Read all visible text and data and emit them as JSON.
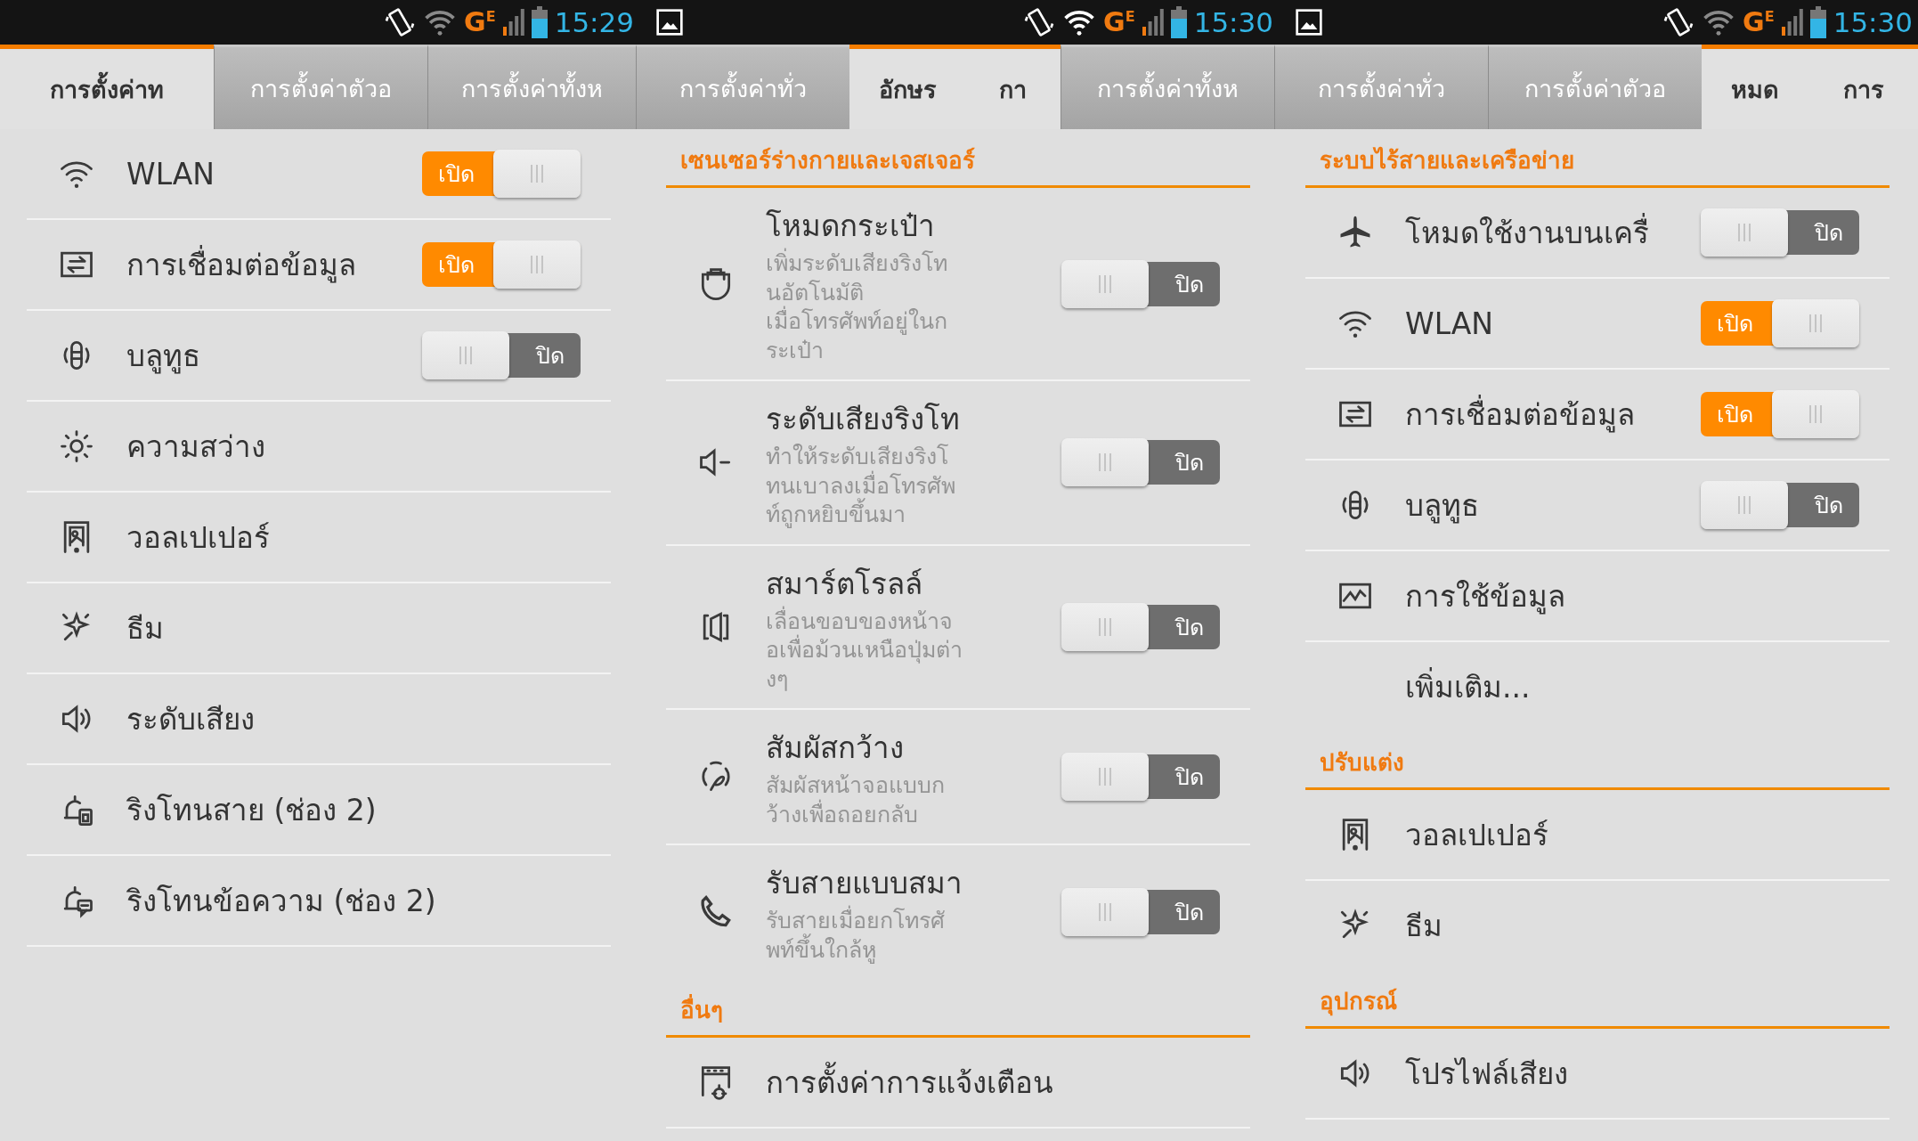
{
  "status_bar": [
    {
      "picture_notification": false,
      "network": "G",
      "network_sub": "E",
      "wifi_connected": false,
      "time": "15:29"
    },
    {
      "picture_notification": true,
      "network": "G",
      "network_sub": "E",
      "wifi_connected": true,
      "time": "15:30"
    },
    {
      "picture_notification": true,
      "network": "G",
      "network_sub": "E",
      "wifi_connected": false,
      "time": "15:30"
    }
  ],
  "tabs": [
    {
      "label": "การตั้งค่าท",
      "selected": true
    },
    {
      "label": "การตั้งค่าตัวอ",
      "selected": false
    },
    {
      "label": "การตั้งค่าทั้งห",
      "selected": false
    },
    {
      "label": "การตั้งค่าทั่ว",
      "selected": false
    },
    {
      "label": "อักษร",
      "selected": true
    },
    {
      "label": "กา",
      "selected": true
    },
    {
      "label": "การตั้งค่าทั้งห",
      "selected": false
    },
    {
      "label": "การตั้งค่าทั่ว",
      "selected": false
    },
    {
      "label": "การตั้งค่าตัวอ",
      "selected": false
    },
    {
      "label": "หมด",
      "selected": true
    },
    {
      "label": "การ",
      "selected": true
    }
  ],
  "panels": [
    {
      "items": [
        {
          "kind": "wifi",
          "title": "WLAN",
          "switch": {
            "on": true,
            "label": "เปิด"
          }
        },
        {
          "kind": "data",
          "title": "การเชื่อมต่อข้อมูล",
          "switch": {
            "on": true,
            "label": "เปิด"
          }
        },
        {
          "kind": "bluetooth",
          "title": "บลูทูธ",
          "switch": {
            "on": false,
            "label": "ปิด"
          }
        },
        {
          "kind": "brightness",
          "title": "ความสว่าง"
        },
        {
          "kind": "wallpaper",
          "title": "วอลเปเปอร์"
        },
        {
          "kind": "theme",
          "title": "ธีม"
        },
        {
          "kind": "volume",
          "title": "ระดับเสียง"
        },
        {
          "kind": "ringtone",
          "title": "ริงโทนสาย (ช่อง 2)"
        },
        {
          "kind": "message",
          "title": "ริงโทนข้อความ (ช่อง 2)"
        }
      ]
    },
    {
      "items": [
        {
          "kind": "header",
          "title": "เซนเซอร์ร่างกายและเจสเจอร์"
        },
        {
          "kind": "pocket",
          "title": "โหมดกระเป๋า",
          "description_lines": [
            "เพิ่มระดับเสียงริงโท",
            "นอัตโนมัติ",
            "เมื่อโทรศัพท์อยู่ในก",
            "ระเป๋า"
          ],
          "switch": {
            "on": false,
            "label": "ปิด"
          }
        },
        {
          "kind": "quiet",
          "title": "ระดับเสียงริงโท",
          "description_lines": [
            "ทำให้ระดับเสียงริงโ",
            "ทนเบาลงเมื่อโทรศัพ",
            "ท์ถูกหยิบขึ้นมา"
          ],
          "switch": {
            "on": false,
            "label": "ปิด"
          }
        },
        {
          "kind": "scroll",
          "title": "สมาร์ตโรลล์",
          "description_lines": [
            "เลื่อนขอบของหน้าจ",
            "อเพื่อม้วนเหนือปุ่มต่า",
            "งๆ"
          ],
          "switch": {
            "on": false,
            "label": "ปิด"
          }
        },
        {
          "kind": "touch",
          "title": "สัมผัสกว้าง",
          "description_lines": [
            "สัมผัสหน้าจอแบบก",
            "ว้างเพื่อถอยกลับ"
          ],
          "switch": {
            "on": false,
            "label": "ปิด"
          }
        },
        {
          "kind": "answer",
          "title": "รับสายแบบสมา",
          "description_lines": [
            "รับสายเมื่อยกโทรศั",
            "พท์ขึ้นใกล้หู"
          ],
          "switch": {
            "on": false,
            "label": "ปิด"
          }
        },
        {
          "kind": "header",
          "title": "อื่นๆ"
        },
        {
          "kind": "notifications",
          "title": "การตั้งค่าการแจ้งเตือน"
        }
      ]
    },
    {
      "items": [
        {
          "kind": "header",
          "title": "ระบบไร้สายและเครือข่าย"
        },
        {
          "kind": "airplane",
          "title": "โหมดใช้งานบนเครื่",
          "switch": {
            "on": false,
            "label": "ปิด"
          }
        },
        {
          "kind": "wifi",
          "title": "WLAN",
          "switch": {
            "on": true,
            "label": "เปิด"
          }
        },
        {
          "kind": "data",
          "title": "การเชื่อมต่อข้อมูล",
          "switch": {
            "on": true,
            "label": "เปิด"
          }
        },
        {
          "kind": "bluetooth",
          "title": "บลูทูธ",
          "switch": {
            "on": false,
            "label": "ปิด"
          }
        },
        {
          "kind": "usage",
          "title": "การใช้ข้อมูล"
        },
        {
          "kind": "more",
          "title": "เพิ่มเติม..."
        },
        {
          "kind": "header",
          "title": "ปรับแต่ง"
        },
        {
          "kind": "wallpaper",
          "title": "วอลเปเปอร์"
        },
        {
          "kind": "theme",
          "title": "ธีม"
        },
        {
          "kind": "header",
          "title": "อุปกรณ์"
        },
        {
          "kind": "volume",
          "title": "โปรไฟล์เสียง"
        }
      ]
    }
  ]
}
